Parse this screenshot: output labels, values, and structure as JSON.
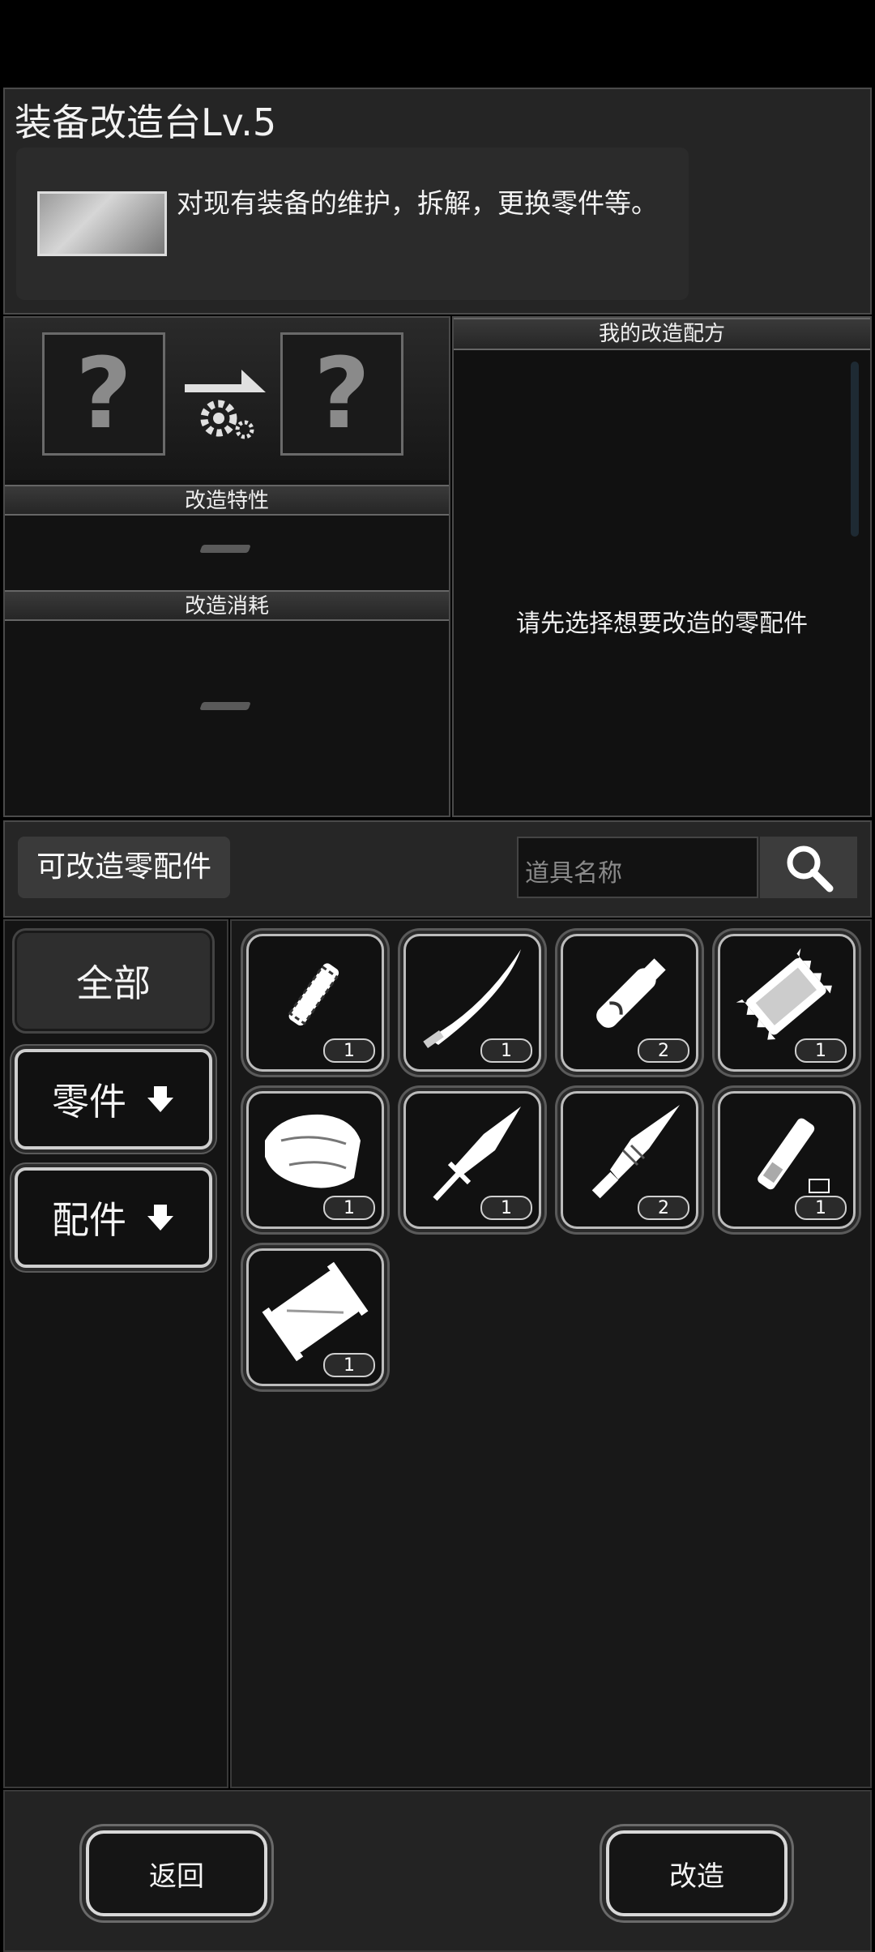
{
  "header": {
    "title": "装备改造台Lv.5",
    "description": "对现有装备的维护，拆解，更换零件等。"
  },
  "modify": {
    "input_placeholder": "?",
    "output_placeholder": "?",
    "traits_label": "改造特性",
    "traits_value": "—",
    "cost_label": "改造消耗",
    "cost_value": "—"
  },
  "recipes": {
    "title": "我的改造配方",
    "empty_hint": "请先选择想要改造的零配件"
  },
  "list": {
    "title": "可改造零配件",
    "search_placeholder": "道具名称"
  },
  "filters": [
    {
      "label": "全部",
      "selected": true
    },
    {
      "label": "零件",
      "icon": "arrow-down-icon"
    },
    {
      "label": "配件",
      "icon": "arrow-down-icon"
    }
  ],
  "items": [
    {
      "icon": "grip-icon",
      "count": "1"
    },
    {
      "icon": "katana-blade-icon",
      "count": "1"
    },
    {
      "icon": "handle-icon",
      "count": "2"
    },
    {
      "icon": "module-icon",
      "count": "1"
    },
    {
      "icon": "armor-plate-icon",
      "count": "1"
    },
    {
      "icon": "dagger-blade-icon",
      "count": "1"
    },
    {
      "icon": "spear-head-icon",
      "count": "2"
    },
    {
      "icon": "energy-cell-icon",
      "count": "1"
    },
    {
      "icon": "frame-icon",
      "count": "1"
    }
  ],
  "footer": {
    "back_label": "返回",
    "modify_label": "改造"
  },
  "colors": {
    "background": "#000000",
    "panel": "#1c1c1c",
    "accent": "#d8d8d8"
  }
}
